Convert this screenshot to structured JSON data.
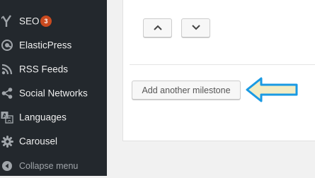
{
  "sidebar": {
    "items": [
      {
        "label": "SEO",
        "icon": "yoast-icon",
        "badge": "3"
      },
      {
        "label": "ElasticPress",
        "icon": "elasticpress-icon"
      },
      {
        "label": "RSS Feeds",
        "icon": "rss-icon"
      },
      {
        "label": "Social Networks",
        "icon": "share-icon"
      },
      {
        "label": "Languages",
        "icon": "translation-icon"
      },
      {
        "label": "Carousel",
        "icon": "gear-icon"
      }
    ],
    "collapse_label": "Collapse menu"
  },
  "milestone": {
    "move_up_icon": "chevron-up-icon",
    "move_down_icon": "chevron-down-icon",
    "add_button_label": "Add another milestone"
  },
  "colors": {
    "sidebar_bg": "#23282d",
    "badge": "#ca4a1f",
    "callout_arrow_stroke": "#1a9ae3",
    "callout_arrow_fill": "#f2ecc4"
  }
}
